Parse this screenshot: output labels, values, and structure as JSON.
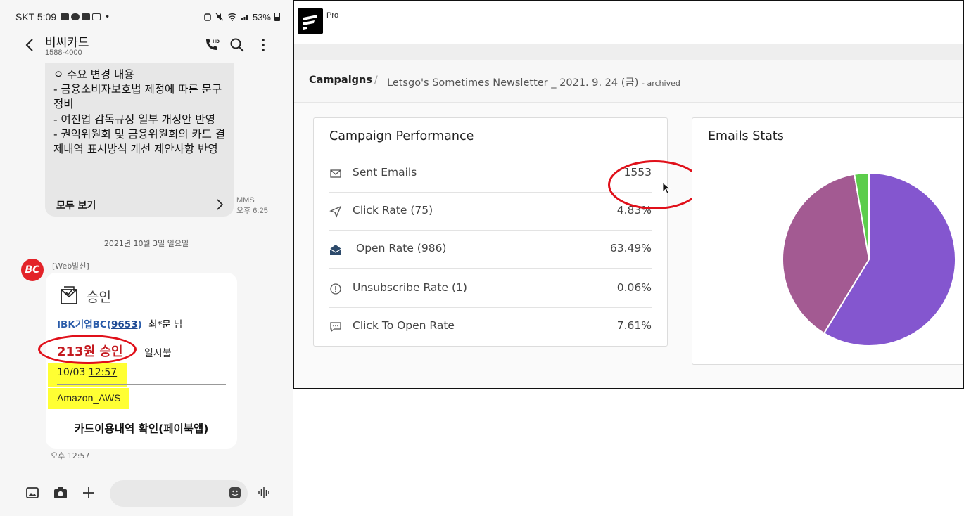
{
  "phone": {
    "status": {
      "carrier_time": "SKT 5:09",
      "dot": "•",
      "battery": "53%"
    },
    "header": {
      "contact_name": "비씨카드",
      "contact_number": "1588-4000"
    },
    "mms": {
      "text": "ㅇ 주요 변경 내용\n- 금융소비자보호법 제정에 따른 문구 정비\n- 여전업 감독규정 일부 개정안 반영\n- 권익위원회 및 금융위원회의 카드 결제내역 표시방식 개선 제안사항 반영",
      "view_all": "모두 보기",
      "type": "MMS",
      "time": "오후 6:25"
    },
    "date_separator": "2021년 10월 3일 일요일",
    "sender_avatar": "BC",
    "sender_tag": "[Web발신]",
    "card": {
      "title": "승인",
      "bank_prefix": "IBK기업BC(",
      "bank_last4": "9653",
      "bank_suffix": ")",
      "customer": "최*문 님",
      "amount": "213원 승인",
      "installment": "일시불",
      "date": "10/03 ",
      "time_underlined": "12:57",
      "merchant": "Amazon_AWS",
      "link": "카드이용내역 확인(페이북앱)"
    },
    "card_time": "오후 12:57"
  },
  "web": {
    "brand_tag": "Pro",
    "breadcrumb": {
      "root": "Campaigns",
      "separator": "/",
      "current": "Letsgo's Sometimes Newsletter _ 2021. 9. 24 (금)",
      "archived": "- archived"
    },
    "performance": {
      "title": "Campaign Performance",
      "rows": [
        {
          "icon": "envelope-icon",
          "label": "Sent Emails",
          "value": "1553"
        },
        {
          "icon": "send-icon",
          "label": "Click Rate (75)",
          "value": "4.83%"
        },
        {
          "icon": "open-envelope-icon",
          "label": "Open Rate (986)",
          "value": "63.49%"
        },
        {
          "icon": "info-icon",
          "label": "Unsubscribe Rate (1)",
          "value": "0.06%"
        },
        {
          "icon": "chat-icon",
          "label": "Click To Open Rate",
          "value": "7.61%"
        }
      ]
    },
    "emails_stats": {
      "title": "Emails Stats"
    }
  },
  "chart_data": {
    "type": "pie",
    "title": "Emails Stats",
    "slices": [
      {
        "value": 58.7,
        "color": "#8456cf"
      },
      {
        "value": 38.6,
        "color": "#a35a92"
      },
      {
        "value": 2.7,
        "color": "#5ccd4b"
      }
    ]
  },
  "colors": {
    "highlight_yellow": "#ffff33",
    "annotation_red": "#e0101a",
    "brand_red": "#e32329"
  }
}
